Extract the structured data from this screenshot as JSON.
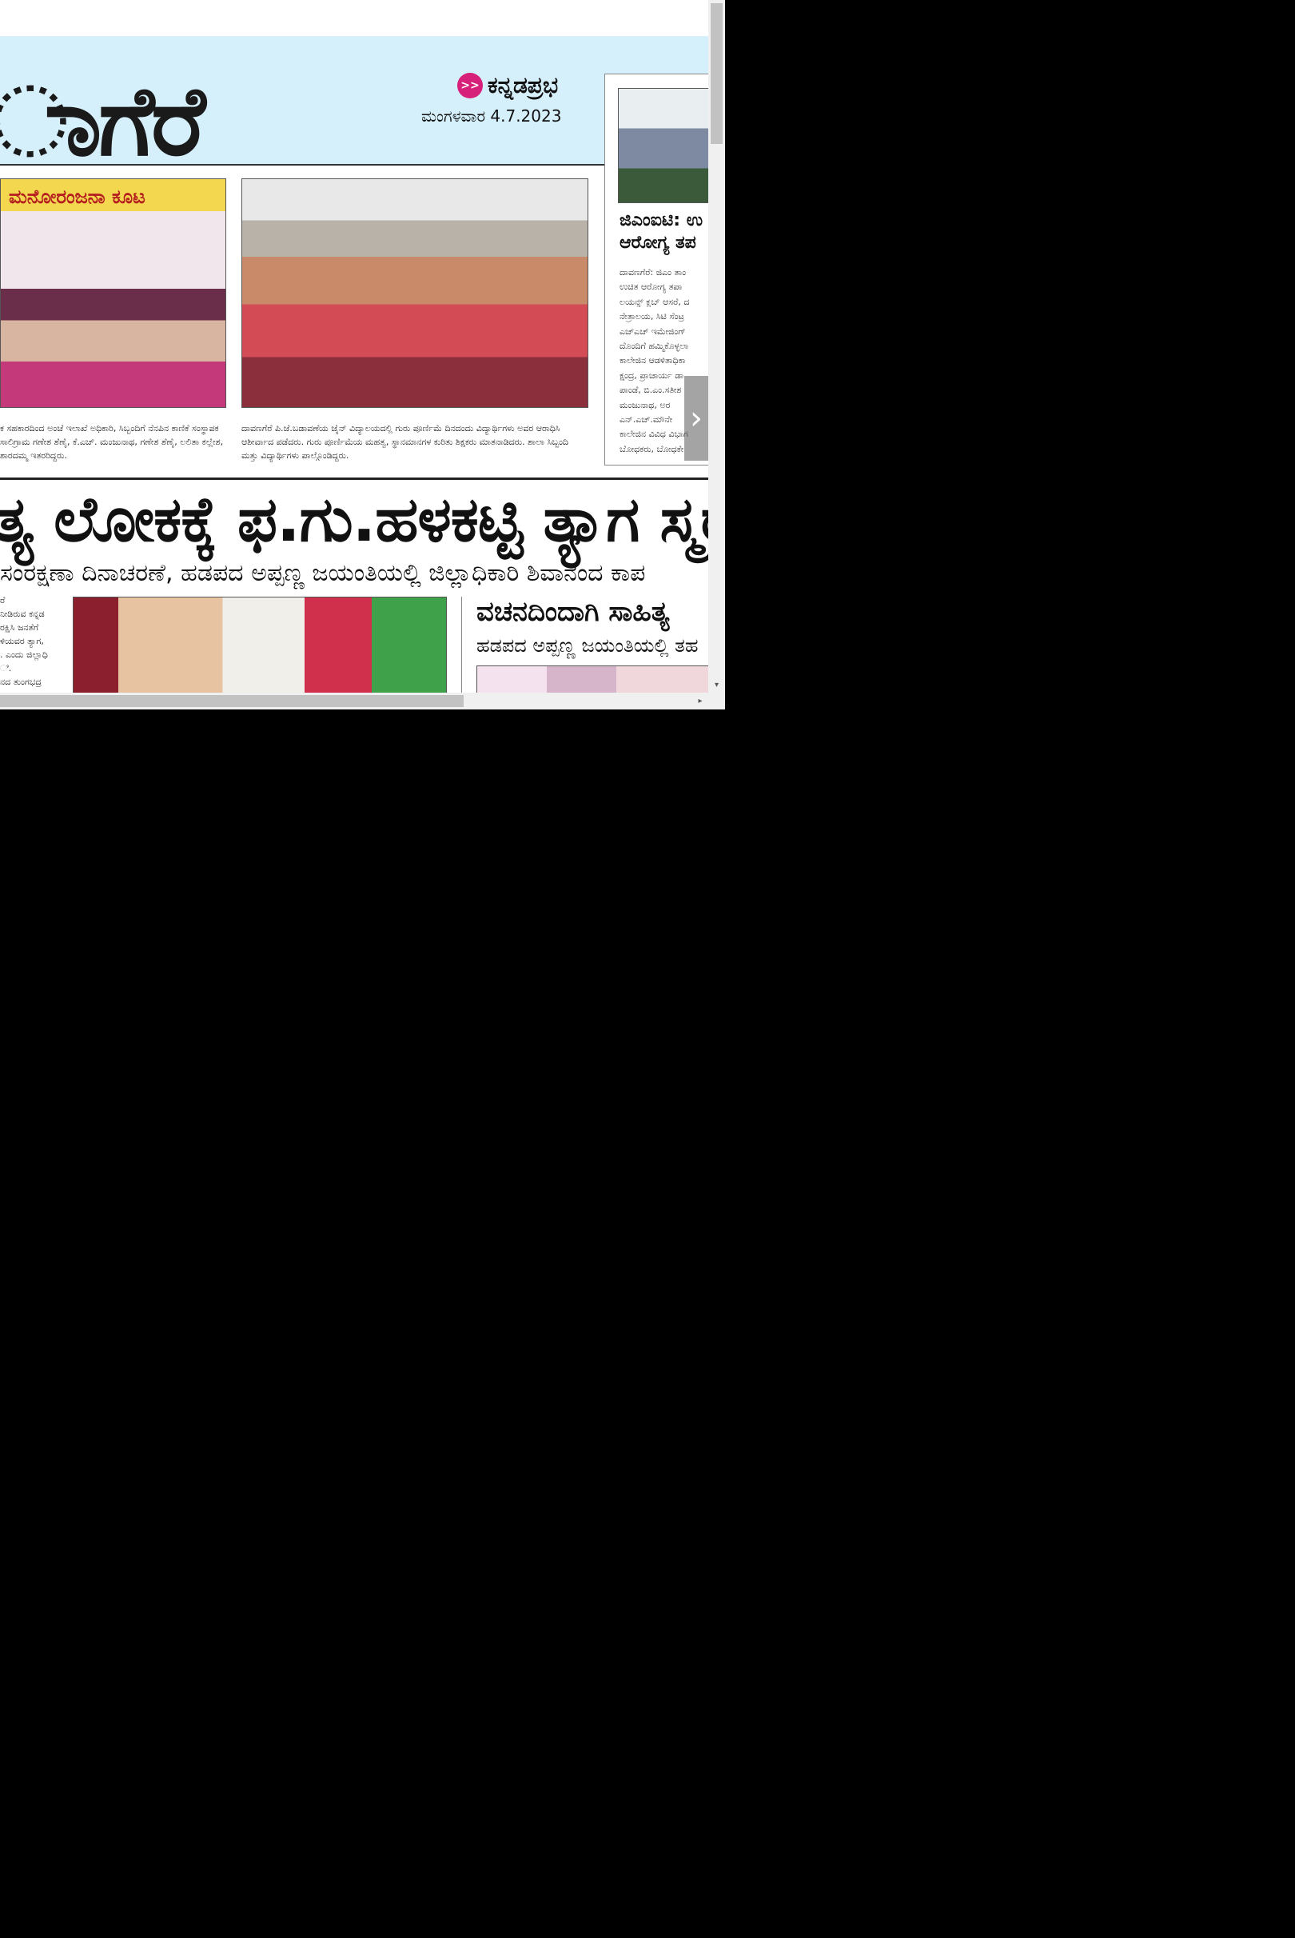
{
  "masthead": {
    "title_fragment": "ಾಗೆರೆ",
    "brand_logo": ">>",
    "brand_name": "ಕನ್ನಡಪ್ರಭ",
    "date": "ಮಂಗಳವಾರ 4.7.2023"
  },
  "photos": {
    "photo1_tag": "ಮನೋರಂಜನಾ ಕೂಟ"
  },
  "captions": {
    "left": "ಕ ಸಹಕಾರದಿಂದ ಅಂಚೆ ಇಲಾಖೆ ಅಧಿಕಾರಿ, ಸಿಬ್ಬಂದಿಗೆ ನೆನಪಿನ ಕಾಣಿಕೆ ಸಂಸ್ಥಾಪಕ ಸಾಲಿಗ್ರಾಮ ಗಣೇಶ ಶೆಣೈ, ಕೆ.ಎಚ್. ಮಂಜುನಾಥ, ಗಣೇಶ ಶೆಣೈ, ಲಲಿತಾ ಕಲ್ಲೇಶ, ಶಾರದಮ್ಮ ಇತರರಿದ್ದರು.",
    "middle": "ದಾವಣಗೆರೆ ಪಿ.ಜೆ.ಬಡಾವಣೆಯ ಜೈನ್ ವಿದ್ಯಾಲಯದಲ್ಲಿ ಗುರು ಪೂರ್ಣಿಮೆ ದಿನದಂದು ವಿದ್ಯಾರ್ಥಿಗಳು ಅವರ ಆರಾಧಿಸಿ ಆಶೀರ್ವಾದ ಪಡೆದರು. ಗುರು ಪೂರ್ಣಿಮೆಯ ಮಹತ್ವ, ಸ್ಥಾನಮಾನಗಳ ಕುರಿತು ಶಿಕ್ಷಕರು ಮಾತನಾಡಿದರು. ಶಾಲಾ ಸಿಬ್ಬಂದಿ ಮತ್ತು ವಿದ್ಯಾರ್ಥಿಗಳು ಪಾಲ್ಗೊಂಡಿದ್ದರು."
  },
  "side_story": {
    "headline_line1": "ಜಿಎಂಐಟಿ: ಉ",
    "headline_line2": "ಆರೋಗ್ಯ ತಪ",
    "lines": [
      "ದಾವಣಗೆರೆ: ಜಿಎಂ ತಾಂ",
      "ಉಚಿತ ಆರೋಗ್ಯ ತಪಾ",
      "ಲಯನ್ಸ್ ಕ್ಲಬ್ ಆಸರೆ, ದ",
      "ನೇತ್ರಾಲಯ, ಸಿಟಿ ಸೆಂಟ್ರ",
      "ಎಚ್‌ಎಚ್ ಇಮೇಜಿಂಗ್",
      "ದೊಂದಿಗೆ ಹಮ್ಮಿಕೊಳ್ಳಲಾ",
      "ಕಾಲೇಜಿನ ಆಡಳಿತಾಧಿಕಾ",
      "ಕ್ಷಂದ್ರ, ಪ್ರಾಚಾರ್ಯ ಡಾ",
      "ಪಾಂಡೆ, ಬಿ.ಎಂ.ಸತೀಶ",
      "ಮಂಜುನಾಥ, ಅರ",
      "ಎನ್.ಎಚ್.ಮೌನೇ",
      "ಕಾಲೇಜಿನ ವಿವಿಧ ವಿಭಾಗ",
      "ಬೋಧಕರು, ಬೋಧಕೇ"
    ]
  },
  "main_story": {
    "headline": "ತ್ಯ ಲೋಕಕ್ಕೆ ಫ.ಗು.ಹಳಕಟ್ಟಿ ತ್ಯಾಗ ಸ್ಮರಣೆ",
    "subhead": "ಸಂರಕ್ಷಣಾ ದಿನಾಚರಣೆ, ಹಡಪದ ಅಪ್ಪಣ್ಣ ಜಯಂತಿಯಲ್ಲಿ ಜಿಲ್ಲಾಧಿಕಾರಿ ಶಿವಾನಂದ ಕಾಪ",
    "column_lines": [
      "ರೆ",
      "ನೀಡಿರುವ ಕನ್ನಡ",
      "ರಕ್ಷಿಸಿ ಜನತೆಗೆ",
      "ಳಿಯವರ ತ್ಯಾಗ,",
      ". ಎಂದು ಜಿಲ್ಲಾಧಿ",
      "ಿ.",
      "ನದ ತುಂಗಭದ್ರ"
    ]
  },
  "right_story": {
    "headline": "ವಚನದಿಂದಾಗಿ ಸಾಹಿತ್ಯ",
    "subhead": "ಹಡಪದ ಅಪ್ಪಣ್ಣ ಜಯಂತಿಯಲ್ಲಿ ತಹ"
  },
  "controls": {
    "next_arrow": "›",
    "scroll_down_arrow": "▾",
    "scroll_right_arrow": "▸"
  }
}
